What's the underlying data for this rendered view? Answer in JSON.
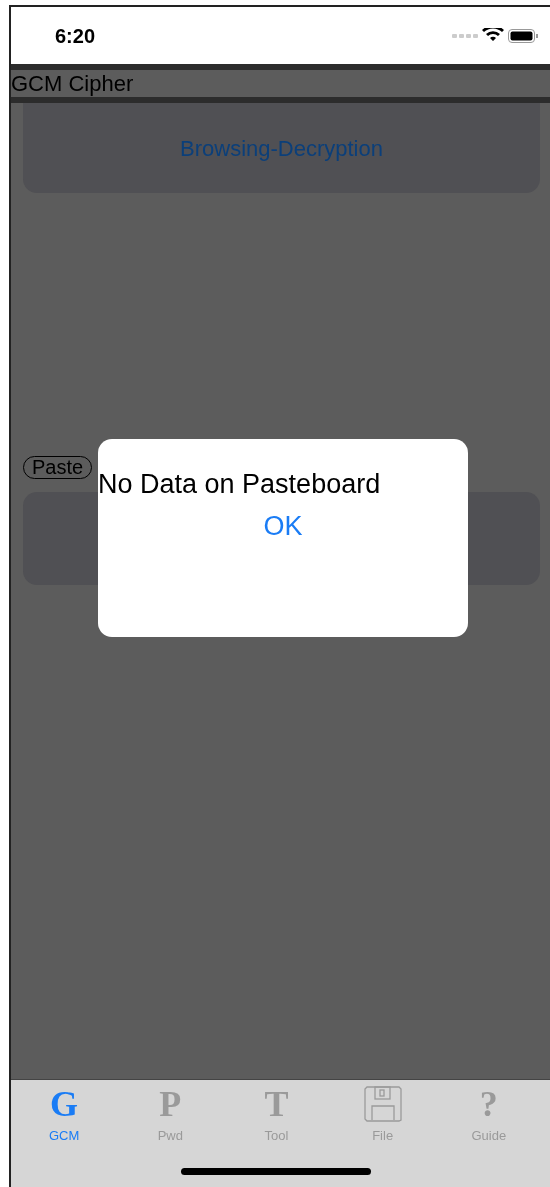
{
  "status_bar": {
    "time": "6:20"
  },
  "navigation_bar": {
    "title": "GCM Cipher"
  },
  "content": {
    "decrypt_button": {
      "label": "Browsing-Decryption"
    },
    "paste_button": {
      "label": "Paste"
    }
  },
  "alert": {
    "message": "No Data on Pasteboard",
    "button": "OK"
  },
  "tab_bar": {
    "tabs": [
      {
        "kind": "letter",
        "glyph": "G",
        "label": "GCM",
        "selected": true
      },
      {
        "kind": "letter",
        "glyph": "P",
        "label": "Pwd",
        "selected": false
      },
      {
        "kind": "letter",
        "glyph": "T",
        "label": "Tool",
        "selected": false
      },
      {
        "kind": "floppy",
        "label": "File",
        "selected": false
      },
      {
        "kind": "letter",
        "glyph": "?",
        "label": "Guide",
        "selected": false
      }
    ]
  }
}
